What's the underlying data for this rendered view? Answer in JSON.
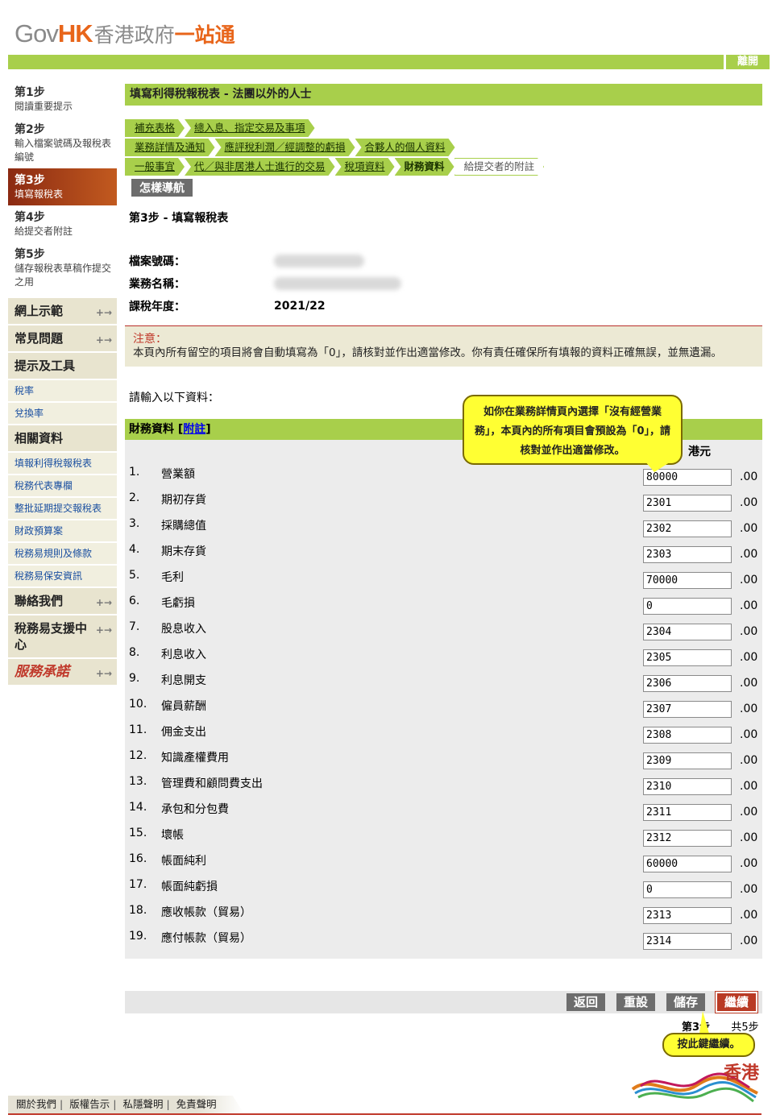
{
  "logo": {
    "gov": "Gov",
    "hk": "HK",
    "cn_grey": "香港政府",
    "cn_orange": "一站通"
  },
  "topbar": {
    "logout": "離開"
  },
  "steps": [
    {
      "title": "第1步",
      "desc": "閱讀重要提示"
    },
    {
      "title": "第2步",
      "desc": "輸入檔案號碼及報稅表編號"
    },
    {
      "title": "第3步",
      "desc": "填寫報稅表"
    },
    {
      "title": "第4步",
      "desc": "給提交者附註"
    },
    {
      "title": "第5步",
      "desc": "儲存報稅表草稿作提交之用"
    }
  ],
  "nav": {
    "demo": "網上示範",
    "faq": "常見問題",
    "tips": "提示及工具",
    "rate": "稅率",
    "exchange": "兌換率",
    "related": "相關資料",
    "related_links": [
      "填報利得稅報稅表",
      "稅務代表專欄",
      "整批延期提交報稅表",
      "財政預算案",
      "稅務易規則及條款",
      "稅務易保安資訊"
    ],
    "contact": "聯絡我們",
    "support": "稅務易支援中心",
    "pledge": "服務承諾"
  },
  "main": {
    "title": "填寫利得稅報稅表 - 法團以外的人士",
    "crumbs_row1": [
      "補充表格",
      "總入息、指定交易及事項"
    ],
    "crumbs_row2": [
      "業務詳情及通知",
      "應評稅利潤／經調整的虧損",
      "合夥人的個人資料"
    ],
    "crumbs_row3": [
      "一般事宜",
      "代／與非居港人士進行的交易",
      "稅項資料"
    ],
    "crumb_current": "財務資料",
    "crumb_todo": "給提交者的附註",
    "howto": "怎樣導航",
    "subhead": "第3步 - 填寫報稅表",
    "file_no_label": "檔案號碼：",
    "biz_name_label": "業務名稱：",
    "year_label": "課稅年度：",
    "year_value": "2021/22",
    "notice_title": "注意：",
    "notice_body": "本頁內所有留空的項目將會自動填寫為「0」，請核對並作出適當修改。你有責任確保所有填報的資料正確無誤，並無遺漏。",
    "prompt": "請輸入以下資料：",
    "section": "財務資料",
    "section_link": "附註",
    "unit": "港元",
    "decimal": ".00"
  },
  "fields": [
    {
      "no": "1.",
      "label": "營業額",
      "value": "80000"
    },
    {
      "no": "2.",
      "label": "期初存貨",
      "value": "2301"
    },
    {
      "no": "3.",
      "label": "採購總值",
      "value": "2302"
    },
    {
      "no": "4.",
      "label": "期末存貨",
      "value": "2303"
    },
    {
      "no": "5.",
      "label": "毛利",
      "value": "70000"
    },
    {
      "no": "6.",
      "label": "毛虧損",
      "value": "0"
    },
    {
      "no": "7.",
      "label": "股息收入",
      "value": "2304"
    },
    {
      "no": "8.",
      "label": "利息收入",
      "value": "2305"
    },
    {
      "no": "9.",
      "label": "利息開支",
      "value": "2306"
    },
    {
      "no": "10.",
      "label": "僱員薪酬",
      "value": "2307"
    },
    {
      "no": "11.",
      "label": "佣金支出",
      "value": "2308"
    },
    {
      "no": "12.",
      "label": "知識產權費用",
      "value": "2309"
    },
    {
      "no": "13.",
      "label": "管理費和顧問費支出",
      "value": "2310"
    },
    {
      "no": "14.",
      "label": "承包和分包費",
      "value": "2311"
    },
    {
      "no": "15.",
      "label": "壞帳",
      "value": "2312"
    },
    {
      "no": "16.",
      "label": "帳面純利",
      "value": "60000"
    },
    {
      "no": "17.",
      "label": "帳面純虧損",
      "value": "0"
    },
    {
      "no": "18.",
      "label": "應收帳款（貿易）",
      "value": "2313"
    },
    {
      "no": "19.",
      "label": "應付帳款（貿易）",
      "value": "2314"
    }
  ],
  "buttons": {
    "back": "返回",
    "reset": "重設",
    "save": "儲存",
    "continue": "繼續"
  },
  "stepcount": {
    "current": "第3步",
    "total": "共5步"
  },
  "bubbles": {
    "info": "如你在業務詳情頁內選擇「沒有經營業務」，本頁內的所有項目會預設為「0」，請核對並作出適當修改。",
    "continue_hint": "按此鍵繼續。"
  },
  "footer": {
    "links": [
      "關於我們",
      "版權告示",
      "私隱聲明",
      "免責聲明"
    ]
  },
  "brand": "香港",
  "colors": {
    "green": "#a8cf4b",
    "orange": "#e8651a",
    "red": "#b93a24",
    "grey_btn": "#6d6d6d",
    "bubble": "#ffff33"
  }
}
